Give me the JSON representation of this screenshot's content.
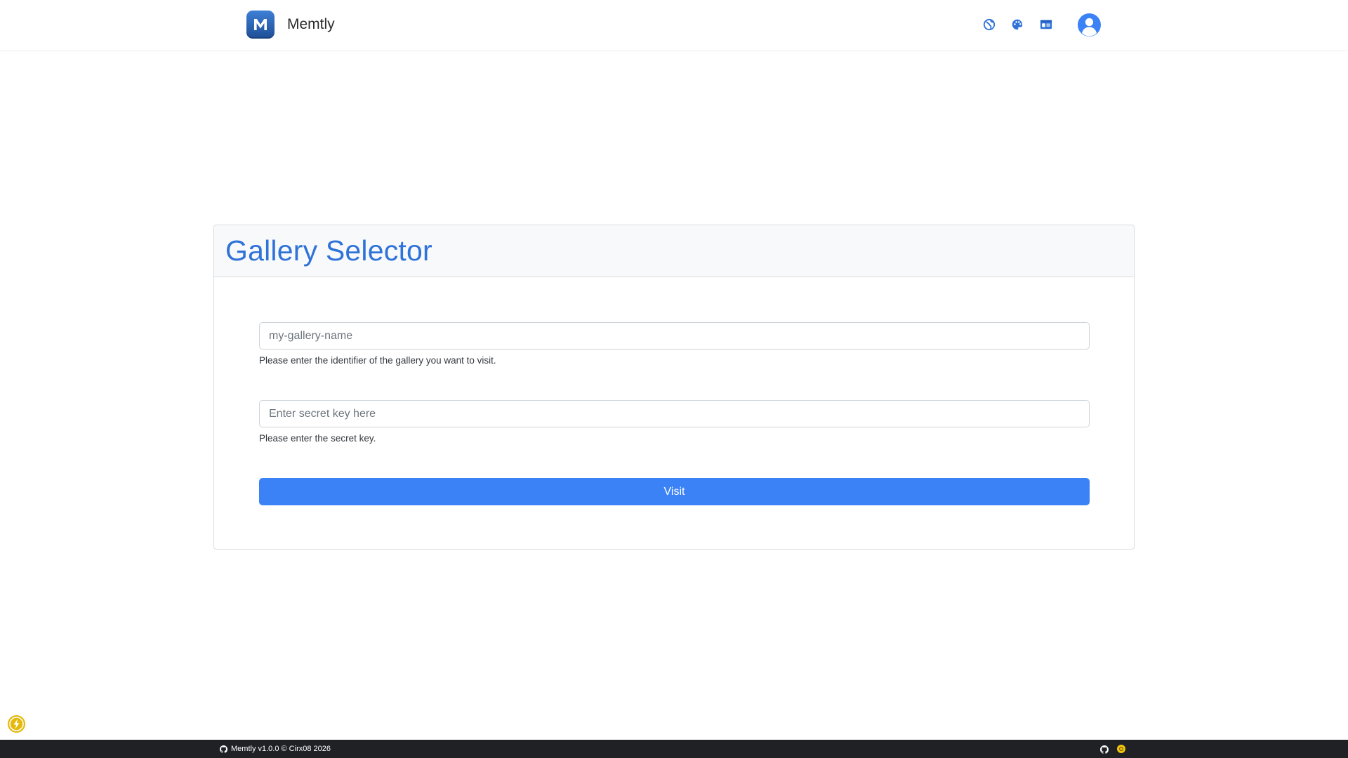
{
  "app": {
    "name": "Memtly",
    "logo_letter": "M"
  },
  "navbar": {
    "icons": [
      {
        "name": "globe-icon"
      },
      {
        "name": "palette-icon"
      },
      {
        "name": "id-card-icon"
      }
    ],
    "avatar_icon": "user-circle-icon"
  },
  "card": {
    "title": "Gallery Selector",
    "gallery_field": {
      "placeholder": "my-gallery-name",
      "value": "",
      "help": "Please enter the identifier of the gallery you want to visit."
    },
    "key_field": {
      "placeholder": "Enter secret key here",
      "value": "",
      "help": "Please enter the secret key."
    },
    "submit_label": "Visit"
  },
  "floating_button": {
    "icon": "lightning-icon"
  },
  "footer": {
    "text": "Memtly v1.0.0 © Cirx08 2026",
    "right_icons": [
      "github-icon",
      "coin-icon"
    ]
  },
  "colors": {
    "accent": "#3b82f6",
    "title": "#2f72d8",
    "footer_bg": "#1f2125",
    "bolt": "#e5b80b"
  }
}
